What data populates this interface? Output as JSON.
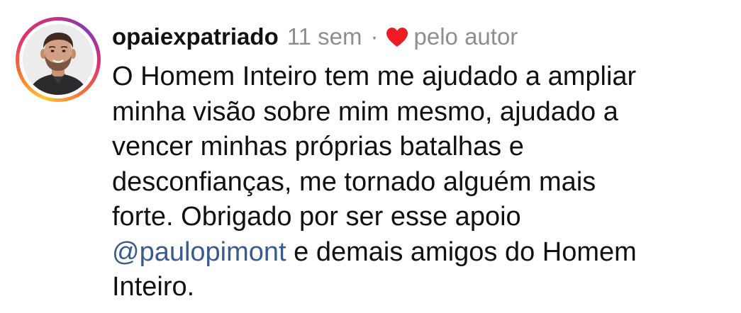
{
  "comment": {
    "username": "opaiexpatriado",
    "time": "11 sem",
    "separator": "·",
    "liked_by_label": "pelo autor",
    "icons": {
      "heart": "heart-icon",
      "avatar": "user-avatar"
    },
    "colors": {
      "heart": "#ed1c24",
      "mention": "#3b5b8f",
      "muted": "#8e8e8e"
    },
    "lines": [
      "O Homem Inteiro tem me ajudado a ampliar",
      "minha visão sobre mim mesmo, ajudado a",
      "vencer minhas próprias batalhas e",
      "desconfianças, me tornado alguém mais",
      "forte. Obrigado por ser esse apoio"
    ],
    "mention": "@paulopimont",
    "mention_rest": " e demais amigos do Homem",
    "last_line": "Inteiro."
  }
}
